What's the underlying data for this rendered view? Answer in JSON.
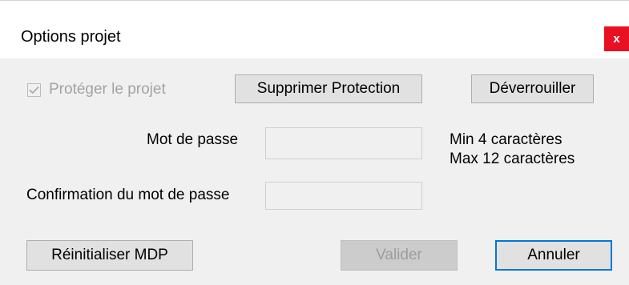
{
  "window": {
    "title": "Options projet",
    "close_label": "x"
  },
  "protection": {
    "checkbox_label": "Protéger le projet",
    "checked": true,
    "remove_protection_label": "Supprimer Protection",
    "unlock_label": "Déverrouiller"
  },
  "password": {
    "label": "Mot de passe",
    "value": "",
    "hint_min": "Min 4 caractères",
    "hint_max": "Max 12 caractères"
  },
  "confirm": {
    "label": "Confirmation du mot de passe",
    "value": ""
  },
  "footer": {
    "reset_label": "Réinitialiser MDP",
    "validate_label": "Valider",
    "cancel_label": "Annuler"
  },
  "colors": {
    "close_button": "#e81123",
    "focus_border": "#0078d7"
  }
}
